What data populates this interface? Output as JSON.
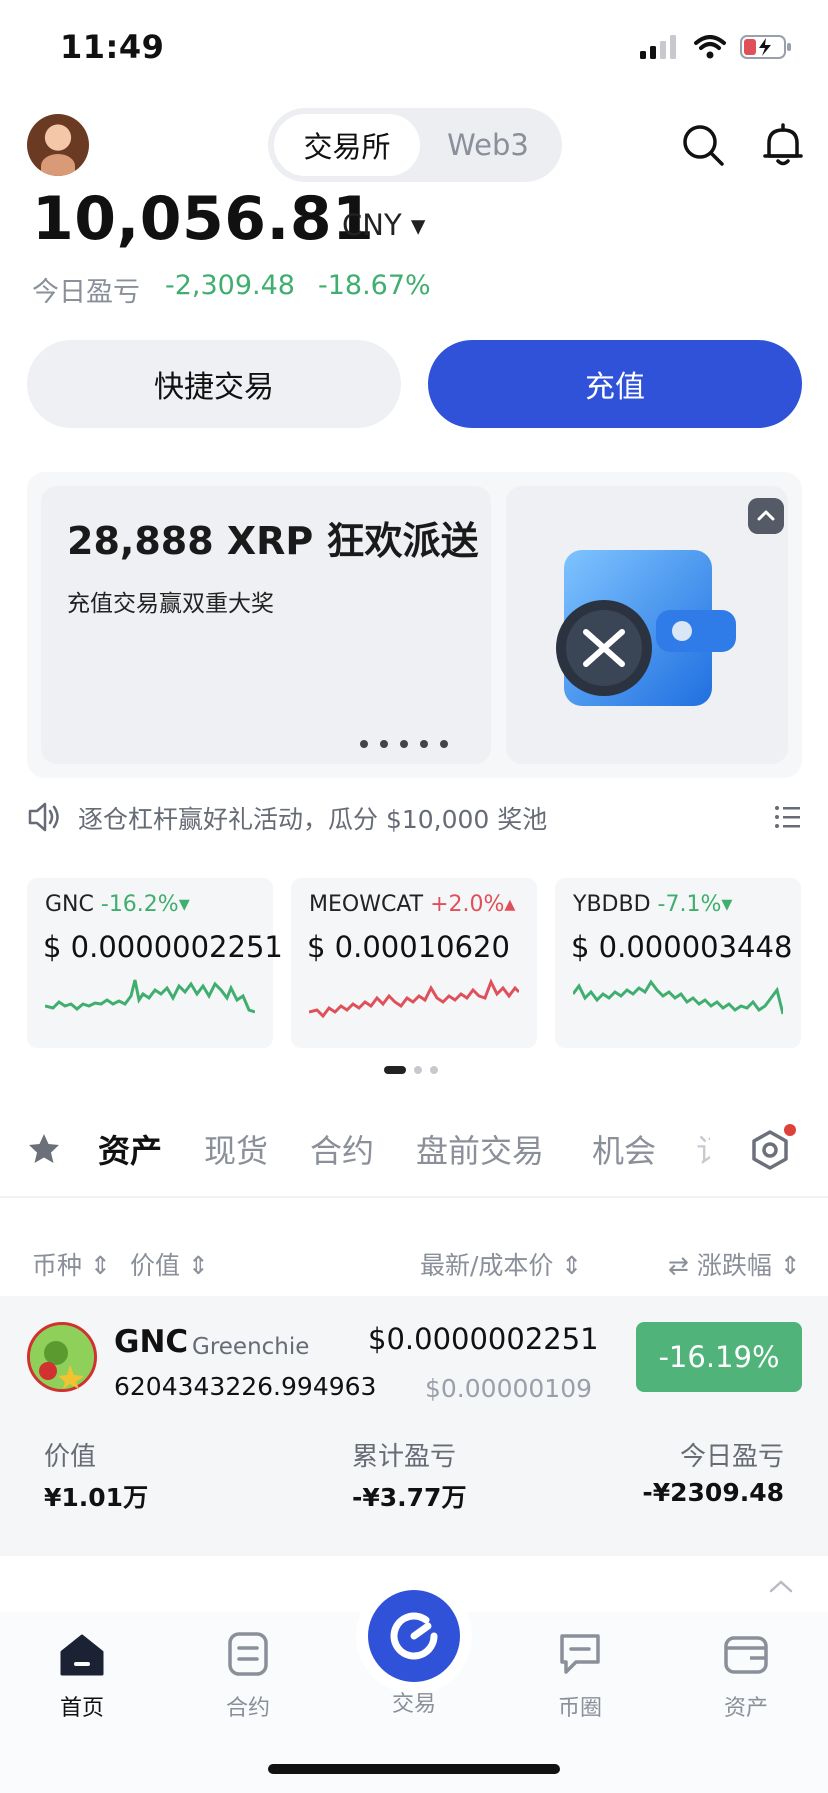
{
  "status": {
    "time": "11:49"
  },
  "header": {
    "tabs": [
      "交易所",
      "Web3"
    ],
    "active_tab": 0
  },
  "account": {
    "balance": "10,056.81",
    "currency": "CNY ▾",
    "pnl_label": "今日盈亏",
    "pnl_value": "-2,309.48",
    "pnl_pct": "-18.67%"
  },
  "actions": {
    "quick_trade": "快捷交易",
    "deposit": "充值"
  },
  "banner": {
    "title": "28,888 XRP 狂欢派送",
    "subtitle": "充值交易赢双重大奖"
  },
  "announcement": "逐仓杠杆赢好礼活动，瓜分 $10,000 奖池",
  "tickers": [
    {
      "symbol": "GNC",
      "change": "-16.2%▾",
      "price": "$ 0.0000002251",
      "trend": "down",
      "color": "#3fae6e"
    },
    {
      "symbol": "MEOWCAT",
      "change": "+2.0%▴",
      "price": "$ 0.00010620",
      "trend": "up",
      "color": "#e0505a"
    },
    {
      "symbol": "YBDBD",
      "change": "-7.1%▾",
      "price": "$ 0.000003448",
      "trend": "down",
      "color": "#3fae6e"
    }
  ],
  "tabs": {
    "items": [
      "资产",
      "现货",
      "合约",
      "盘前交易",
      "机会",
      "订"
    ],
    "active": 0
  },
  "columns": {
    "coin": "币种",
    "value": "价值",
    "price": "最新/成本价",
    "change": "涨跌幅"
  },
  "asset": {
    "symbol": "GNC",
    "name": "Greenchie",
    "quantity": "6204343226.994963",
    "price": "$0.0000002251",
    "cost": "$0.00000109",
    "change": "-16.19%",
    "value_label": "价值",
    "value": "¥1.01万",
    "cum_pnl_label": "累计盈亏",
    "cum_pnl": "-¥3.77万",
    "today_pnl_label": "今日盈亏",
    "today_pnl": "-¥2309.48"
  },
  "nav": {
    "home": "首页",
    "futures": "合约",
    "trade": "交易",
    "community": "币圈",
    "assets": "资产"
  }
}
